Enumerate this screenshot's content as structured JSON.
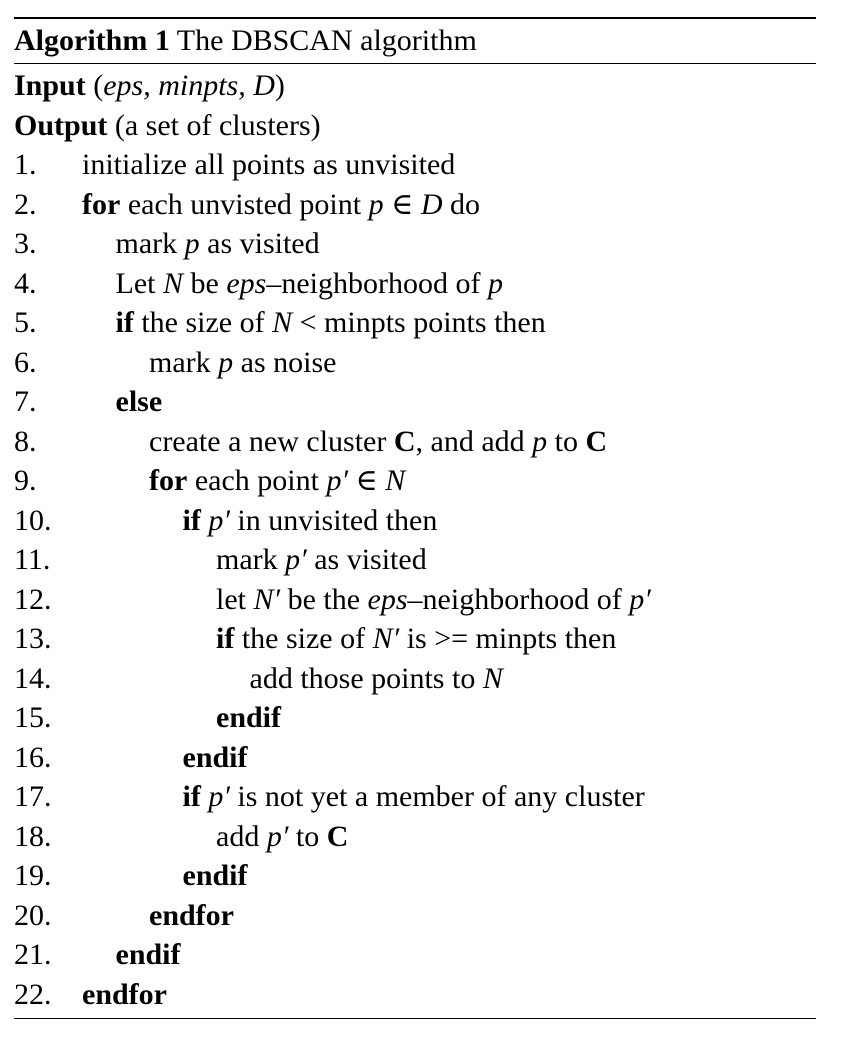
{
  "caption": {
    "label": "Algorithm 1",
    "title": "The DBSCAN algorithm"
  },
  "io": [
    {
      "keyword": "Input",
      "parts": [
        {
          "t": " (",
          "s": "n"
        },
        {
          "t": "eps, minpts, D",
          "s": "m"
        },
        {
          "t": ")",
          "s": "n"
        }
      ]
    },
    {
      "keyword": "Output",
      "parts": [
        {
          "t": " (a set of clusters)",
          "s": "n"
        }
      ]
    }
  ],
  "lines": [
    {
      "n": "1.",
      "indent": 0,
      "parts": [
        {
          "t": "initialize all points as unvisited",
          "s": "n"
        }
      ]
    },
    {
      "n": "2.",
      "indent": 0,
      "parts": [
        {
          "t": "for",
          "s": "k"
        },
        {
          "t": " each unvisted point ",
          "s": "n"
        },
        {
          "t": "p",
          "s": "m"
        },
        {
          "t": " ∈ ",
          "s": "n"
        },
        {
          "t": "D",
          "s": "m"
        },
        {
          "t": " do",
          "s": "n"
        }
      ]
    },
    {
      "n": "3.",
      "indent": 1,
      "parts": [
        {
          "t": "mark ",
          "s": "n"
        },
        {
          "t": "p",
          "s": "m"
        },
        {
          "t": " as visited",
          "s": "n"
        }
      ]
    },
    {
      "n": "4.",
      "indent": 1,
      "parts": [
        {
          "t": "Let ",
          "s": "n"
        },
        {
          "t": "N",
          "s": "m"
        },
        {
          "t": " be ",
          "s": "n"
        },
        {
          "t": "eps",
          "s": "m"
        },
        {
          "t": "–neighborhood of ",
          "s": "n"
        },
        {
          "t": "p",
          "s": "m"
        }
      ]
    },
    {
      "n": "5.",
      "indent": 1,
      "parts": [
        {
          "t": "if",
          "s": "k"
        },
        {
          "t": " the size of ",
          "s": "n"
        },
        {
          "t": "N",
          "s": "m"
        },
        {
          "t": " < minpts points then",
          "s": "n"
        }
      ]
    },
    {
      "n": "6.",
      "indent": 2,
      "parts": [
        {
          "t": "mark ",
          "s": "n"
        },
        {
          "t": "p",
          "s": "m"
        },
        {
          "t": " as noise",
          "s": "n"
        }
      ]
    },
    {
      "n": "7.",
      "indent": 1,
      "parts": [
        {
          "t": "else",
          "s": "k"
        }
      ]
    },
    {
      "n": "8.",
      "indent": 2,
      "parts": [
        {
          "t": "create a new cluster ",
          "s": "n"
        },
        {
          "t": "C",
          "s": "k"
        },
        {
          "t": ", and add ",
          "s": "n"
        },
        {
          "t": "p",
          "s": "m"
        },
        {
          "t": " to ",
          "s": "n"
        },
        {
          "t": "C",
          "s": "k"
        }
      ]
    },
    {
      "n": "9.",
      "indent": 2,
      "parts": [
        {
          "t": "for",
          "s": "k"
        },
        {
          "t": " each point ",
          "s": "n"
        },
        {
          "t": "p′",
          "s": "m"
        },
        {
          "t": " ∈ ",
          "s": "n"
        },
        {
          "t": "N",
          "s": "m"
        }
      ]
    },
    {
      "n": "10.",
      "indent": 3,
      "parts": [
        {
          "t": "if",
          "s": "k"
        },
        {
          "t": " ",
          "s": "n"
        },
        {
          "t": "p′",
          "s": "m"
        },
        {
          "t": " in unvisited then",
          "s": "n"
        }
      ]
    },
    {
      "n": "11.",
      "indent": 4,
      "parts": [
        {
          "t": "mark ",
          "s": "n"
        },
        {
          "t": "p′",
          "s": "m"
        },
        {
          "t": " as visited",
          "s": "n"
        }
      ]
    },
    {
      "n": "12.",
      "indent": 4,
      "parts": [
        {
          "t": "let ",
          "s": "n"
        },
        {
          "t": "N′",
          "s": "m"
        },
        {
          "t": " be the ",
          "s": "n"
        },
        {
          "t": "eps",
          "s": "m"
        },
        {
          "t": "–neighborhood of ",
          "s": "n"
        },
        {
          "t": "p′",
          "s": "m"
        }
      ]
    },
    {
      "n": "13.",
      "indent": 4,
      "parts": [
        {
          "t": "if",
          "s": "k"
        },
        {
          "t": " the size of ",
          "s": "n"
        },
        {
          "t": "N′",
          "s": "m"
        },
        {
          "t": " is >= minpts then",
          "s": "n"
        }
      ]
    },
    {
      "n": "14.",
      "indent": 5,
      "parts": [
        {
          "t": "add those points to ",
          "s": "n"
        },
        {
          "t": "N",
          "s": "m"
        }
      ]
    },
    {
      "n": "15.",
      "indent": 4,
      "parts": [
        {
          "t": "endif",
          "s": "k"
        }
      ]
    },
    {
      "n": "16.",
      "indent": 3,
      "parts": [
        {
          "t": "endif",
          "s": "k"
        }
      ]
    },
    {
      "n": "17.",
      "indent": 3,
      "parts": [
        {
          "t": "if",
          "s": "k"
        },
        {
          "t": " ",
          "s": "n"
        },
        {
          "t": "p′",
          "s": "m"
        },
        {
          "t": " is not yet a member of any cluster",
          "s": "n"
        }
      ]
    },
    {
      "n": "18.",
      "indent": 4,
      "parts": [
        {
          "t": "add ",
          "s": "n"
        },
        {
          "t": "p′",
          "s": "m"
        },
        {
          "t": " to ",
          "s": "n"
        },
        {
          "t": "C",
          "s": "k"
        }
      ]
    },
    {
      "n": "19.",
      "indent": 3,
      "parts": [
        {
          "t": "endif",
          "s": "k"
        }
      ]
    },
    {
      "n": "20.",
      "indent": 2,
      "parts": [
        {
          "t": "endfor",
          "s": "k"
        }
      ]
    },
    {
      "n": "21.",
      "indent": 1,
      "parts": [
        {
          "t": "endif",
          "s": "k"
        }
      ]
    },
    {
      "n": "22.",
      "indent": 0,
      "parts": [
        {
          "t": "endfor",
          "s": "k"
        }
      ]
    }
  ]
}
